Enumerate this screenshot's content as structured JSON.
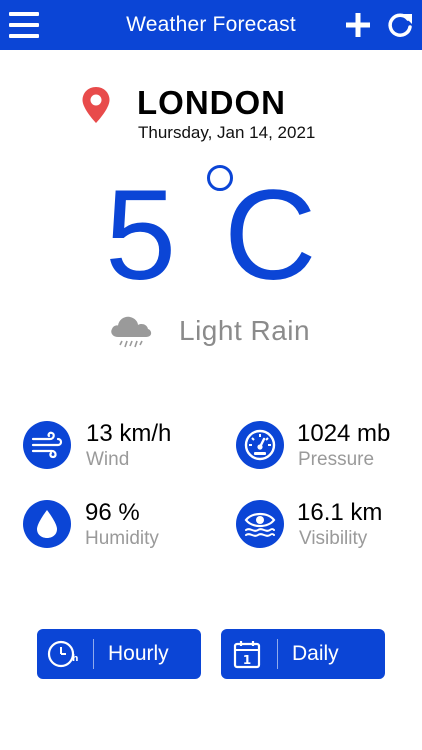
{
  "appbar": {
    "title": "Weather Forecast",
    "menu_icon": "hamburger-menu-icon",
    "add_icon": "plus-icon",
    "refresh_icon": "refresh-icon",
    "color": "#0b45d6"
  },
  "location": {
    "city": "LONDON",
    "date": "Thursday, Jan 14, 2021",
    "pin_color": "#e84b4b"
  },
  "current": {
    "temperature": "5",
    "unit": "C",
    "condition": "Light Rain",
    "condition_icon": "rain-cloud-icon"
  },
  "stats": {
    "wind": {
      "value": "13 km/h",
      "label": "Wind",
      "icon": "wind-icon"
    },
    "pressure": {
      "value": "1024 mb",
      "label": "Pressure",
      "icon": "gauge-icon"
    },
    "humidity": {
      "value": "96 %",
      "label": "Humidity",
      "icon": "water-drop-icon"
    },
    "visibility": {
      "value": "16.1 km",
      "label": "Visibility",
      "icon": "eye-waves-icon"
    }
  },
  "buttons": {
    "hourly": {
      "label": "Hourly",
      "icon": "clock-24h-icon"
    },
    "daily": {
      "label": "Daily",
      "icon": "calendar-icon",
      "icon_number": "1"
    }
  }
}
